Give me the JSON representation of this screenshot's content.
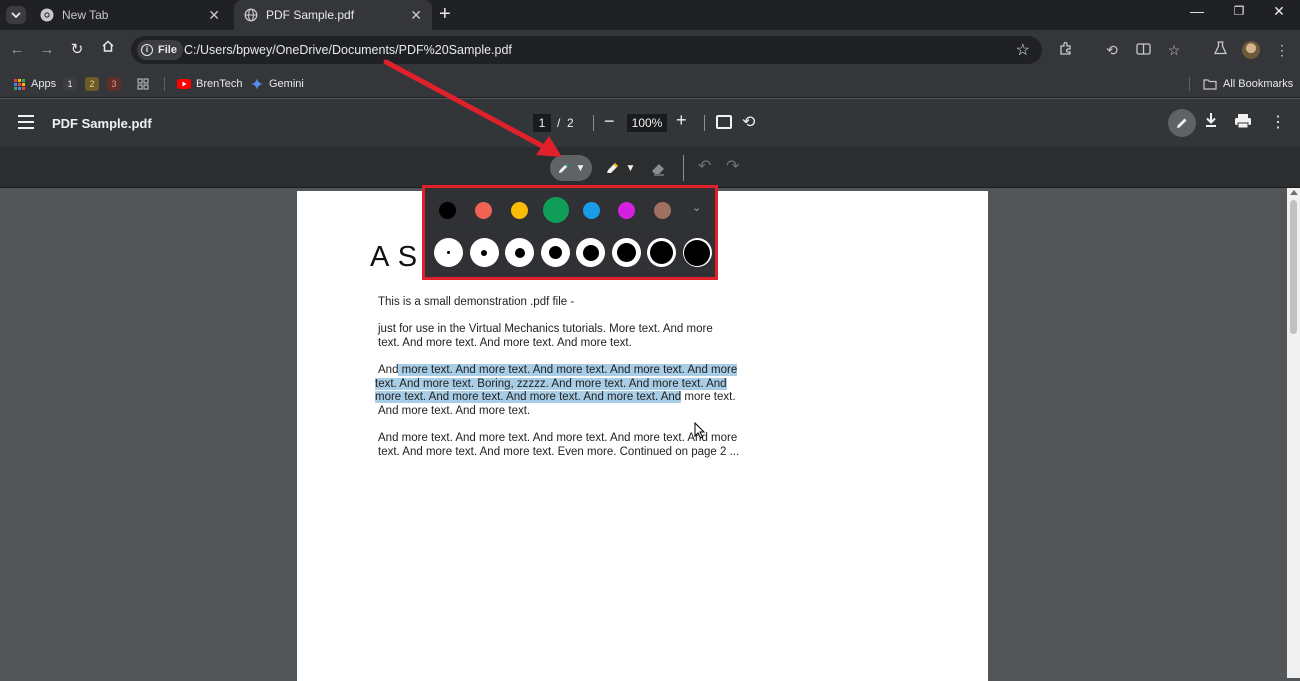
{
  "browser": {
    "tabs": [
      {
        "title": "New Tab",
        "active": false
      },
      {
        "title": "PDF Sample.pdf",
        "active": true
      }
    ],
    "address": {
      "scheme_chip": "File",
      "url": "C:/Users/bpwey/OneDrive/Documents/PDF%20Sample.pdf"
    },
    "bookmarks": {
      "apps_label": "Apps",
      "numbered": [
        "1",
        "2",
        "3"
      ],
      "items": [
        {
          "label": "BrenTech",
          "icon": "youtube-icon"
        },
        {
          "label": "Gemini",
          "icon": "gemini-sparkle-icon"
        }
      ],
      "all_bookmarks_label": "All Bookmarks"
    }
  },
  "pdf_viewer": {
    "title": "PDF Sample.pdf",
    "current_page": "1",
    "page_separator": "/",
    "total_pages": "2",
    "zoom": "100%",
    "annotation_tools": {
      "pen_color": "#0f9d58",
      "highlighter_color": "#fbbc04",
      "tools": [
        "pen",
        "highlighter",
        "eraser",
        "undo",
        "redo"
      ]
    },
    "pen_popup": {
      "colors": [
        "#000000",
        "#f06352",
        "#fbbc04",
        "#0f9d58",
        "#1a9be8",
        "#d620e0",
        "#a07060"
      ],
      "selected_color_index": 3,
      "sizes": [
        1,
        2,
        3,
        4,
        5,
        6,
        7,
        8
      ],
      "expand_icon": "chevron-down-icon"
    }
  },
  "document": {
    "heading": "A S",
    "paragraphs": [
      "This is a small demonstration .pdf file -",
      "just for use in the Virtual Mechanics tutorials. More text. And more",
      "text. And more text. And more text. And more text.",
      {
        "pre": "And",
        "hl": " more text. And more text. And more text. And more text. And more",
        "post": ""
      },
      {
        "pre": "",
        "hl": "text. And more text. Boring, zzzzz. And more text. And more text. And",
        "post": ""
      },
      {
        "pre": "",
        "hl": "more text. And more text. And more text. And more text. And",
        "post": " more text."
      },
      "And more text. And more text.",
      "And more text. And more text. And more text. And more text. And more",
      "text. And more text. And more text. Even more. Continued on page 2 ..."
    ]
  },
  "annotation_overlay": {
    "arrow_color": "#e0202a",
    "highlight_box_color": "#e0202a"
  }
}
